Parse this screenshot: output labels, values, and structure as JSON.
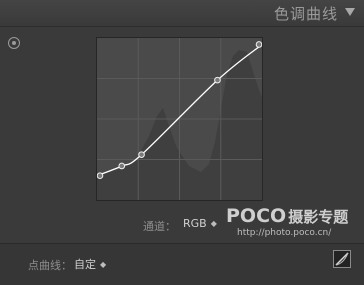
{
  "panel": {
    "title": "色调曲线"
  },
  "channel": {
    "label": "通道：",
    "value": "RGB"
  },
  "point_curve": {
    "label": "点曲线：",
    "value": "自定"
  },
  "watermark": {
    "brand": "POCO",
    "brand_sub": "摄影专题",
    "url": "http://photo.poco.cn/"
  },
  "icons": {
    "collapse": "triangle-down-icon",
    "target": "targeted-adjustment-icon",
    "edit": "edit-point-curve-icon",
    "updown": "up-down-arrows-icon"
  },
  "colors": {
    "panel_bg": "#3a3a3a",
    "graph_bg": "#4a4a4a",
    "curve": "#ffffff",
    "text_label": "#8e8e8e",
    "text_value": "#d0d0d0"
  },
  "curve": {
    "points": [
      {
        "input": 0,
        "output": 15
      },
      {
        "input": 15,
        "output": 21
      },
      {
        "input": 27,
        "output": 28
      },
      {
        "input": 73,
        "output": 74
      },
      {
        "input": 100,
        "output": 96
      }
    ]
  }
}
